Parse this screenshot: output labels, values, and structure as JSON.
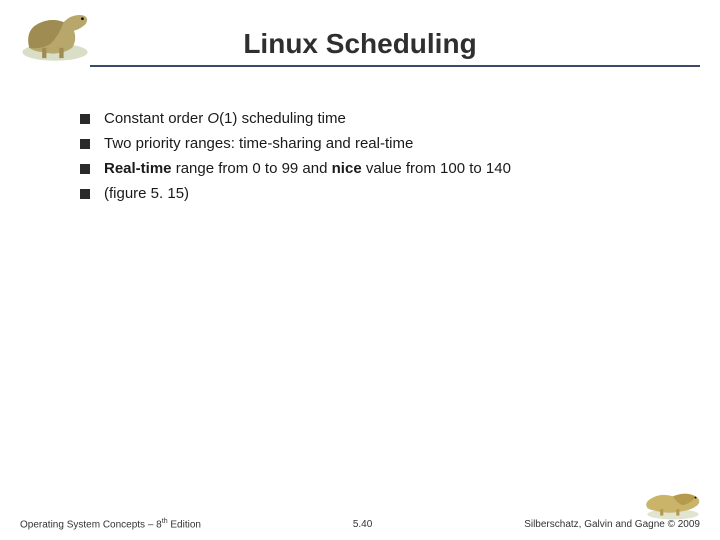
{
  "title": "Linux Scheduling",
  "bullets": [
    {
      "pre": "Constant order ",
      "emO": "O",
      "emRest": "(1) scheduling time",
      "post": ""
    },
    {
      "pre": "Two priority ranges: time-sharing and real-time",
      "emO": "",
      "emRest": "",
      "post": ""
    },
    {
      "pre": "",
      "b1": "Real-time",
      "mid": " range from 0 to 99 and ",
      "b2": "nice",
      "post": " value from 100 to 140"
    },
    {
      "pre": "(figure 5. 15)",
      "emO": "",
      "emRest": "",
      "post": ""
    }
  ],
  "footer": {
    "left_pre": "Operating System Concepts – 8",
    "left_sup": "th",
    "left_post": " Edition",
    "center": "5.40",
    "right": "Silberschatz, Galvin and Gagne © 2009"
  }
}
